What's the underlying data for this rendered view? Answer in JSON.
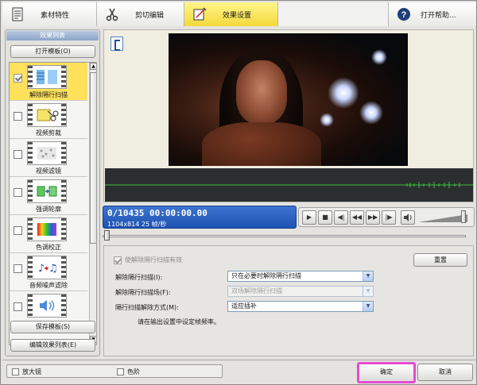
{
  "tabs": [
    {
      "label": "素材特性",
      "icon": "document-icon",
      "active": false
    },
    {
      "label": "剪切编辑",
      "icon": "scissors-icon",
      "active": false
    },
    {
      "label": "效果设置",
      "icon": "effect-settings-icon",
      "active": true
    },
    {
      "label": "打开帮助...",
      "icon": "help-icon",
      "active": false
    }
  ],
  "effects_panel": {
    "header": "效果列表",
    "open_template_label": "打开模板(O)",
    "save_template_label": "保存模板(S)",
    "edit_list_label": "编辑效果列表(E)",
    "items": [
      {
        "label": "解除隔行扫描",
        "checked": true,
        "selected": true,
        "icon": "deinterlace-icon"
      },
      {
        "label": "视频剪裁",
        "checked": false,
        "selected": false,
        "icon": "video-crop-icon"
      },
      {
        "label": "视频滤镜",
        "checked": false,
        "selected": false,
        "icon": "video-filter-icon"
      },
      {
        "label": "强调轮廓",
        "checked": false,
        "selected": false,
        "icon": "outline-enhance-icon"
      },
      {
        "label": "色调校正",
        "checked": false,
        "selected": false,
        "icon": "color-correction-icon"
      },
      {
        "label": "音频噪声滤除",
        "checked": false,
        "selected": false,
        "icon": "audio-noise-filter-icon"
      },
      {
        "label": "",
        "checked": false,
        "selected": false,
        "icon": "audio-volume-icon"
      }
    ]
  },
  "player": {
    "timecode": "0/10435  00:00:00.00",
    "info": "1104x814 25  帧/秒",
    "seek_position": 0.0,
    "volume_level": 0.9,
    "transport_icons": [
      "play-icon",
      "stop-icon",
      "prev-frame-icon",
      "rewind-icon",
      "fast-forward-icon",
      "next-frame-icon",
      "speaker-icon"
    ]
  },
  "settings": {
    "enable_label": "使解除隔行扫描有效",
    "reset_label": "重置",
    "fields": [
      {
        "label": "解除隔行扫描(I):",
        "value": "只在必要时解除隔行扫描",
        "disabled": false
      },
      {
        "label": "解除隔行扫描场(F):",
        "value": "双场解除隔行扫描",
        "disabled": true
      },
      {
        "label": "隔行扫描解除方式(M):",
        "value": "适应插补",
        "disabled": false
      }
    ],
    "note": "请在输出设置中设定帧频率。"
  },
  "bottom": {
    "magnifier_label": "放大镜",
    "color_levels_label": "色阶",
    "ok_label": "确定",
    "cancel_label": "取消"
  },
  "colors": {
    "accent_active_tab": "#f3d93c",
    "timecode_bg": "#2a62c4",
    "ok_highlight": "#e64bd0",
    "waveform": "#3fbf3f"
  }
}
